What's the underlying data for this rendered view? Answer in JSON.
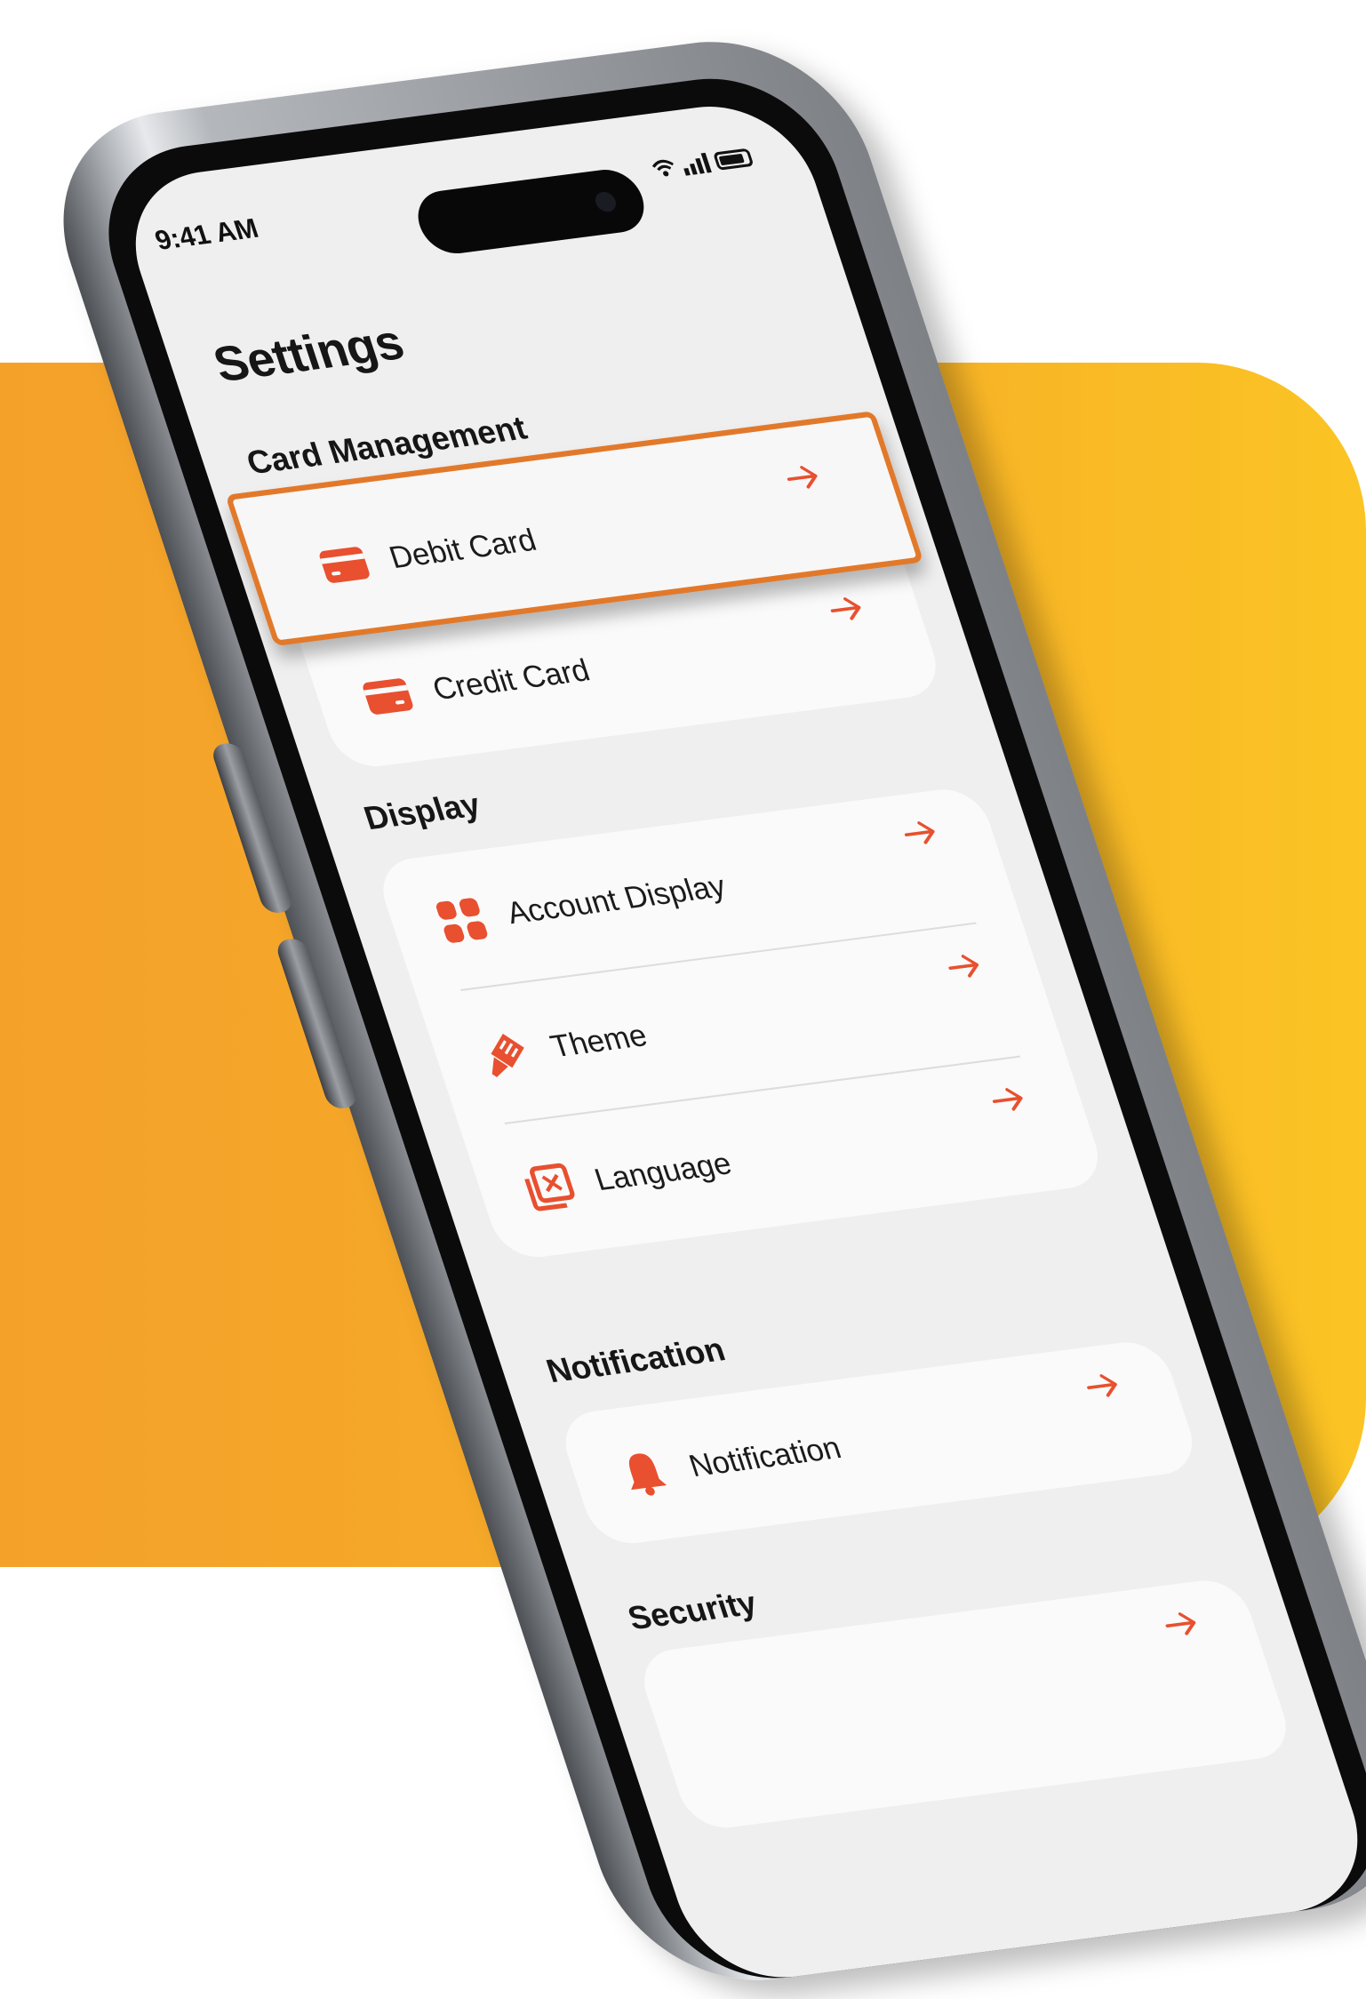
{
  "status_bar": {
    "time": "9:41 AM"
  },
  "screen": {
    "title": "Settings"
  },
  "sections": {
    "card_management": {
      "title": "Card Management",
      "items": [
        {
          "label": "Debit Card"
        },
        {
          "label": "Credit Card"
        }
      ]
    },
    "display": {
      "title": "Display",
      "items": [
        {
          "label": "Account Display"
        },
        {
          "label": "Theme"
        },
        {
          "label": "Language"
        }
      ]
    },
    "notification": {
      "title": "Notification",
      "items": [
        {
          "label": "Notification"
        }
      ]
    },
    "security": {
      "title": "Security"
    }
  },
  "colors": {
    "accent": "#e8502f",
    "highlight_border": "#e2792a",
    "background_panel": "#f6ad28",
    "screen_bg": "#efefef"
  },
  "icons": {
    "debit_card": "credit-card-icon",
    "credit_card": "credit-card-icon",
    "account_display": "grid-icon",
    "theme": "paint-brush-icon",
    "language": "translate-icon",
    "notification": "bell-icon",
    "row_arrow": "arrow-right-icon"
  }
}
